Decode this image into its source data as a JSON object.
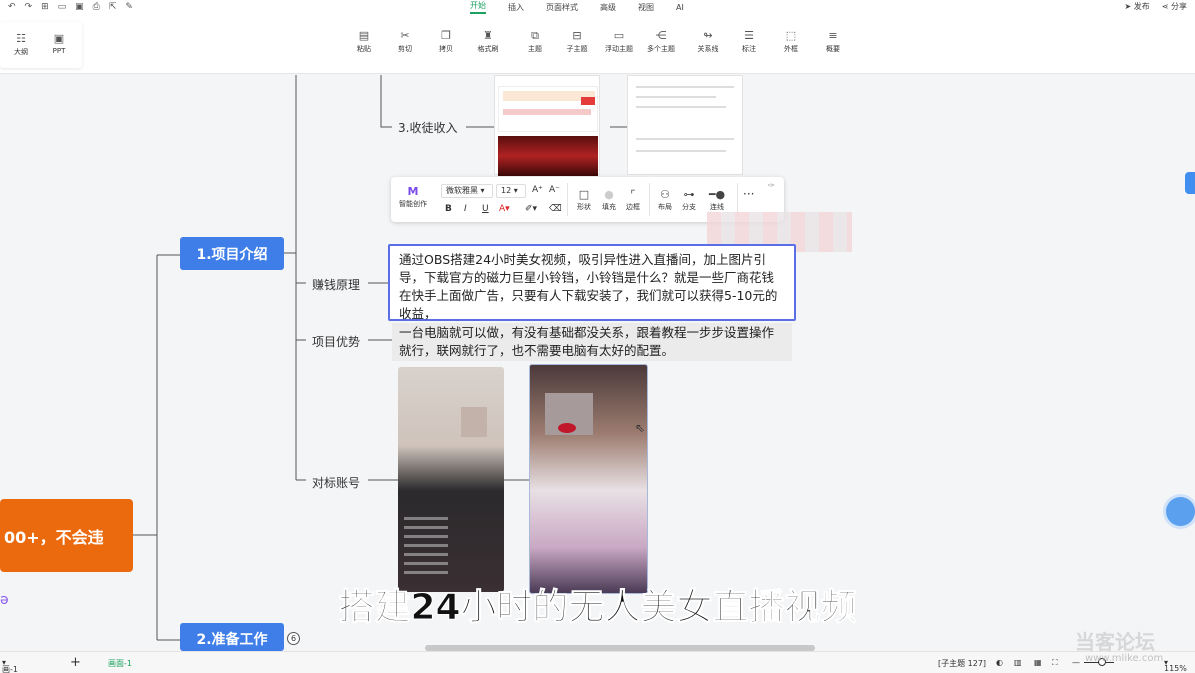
{
  "topbar": {
    "menus": [
      "开始",
      "插入",
      "页面样式",
      "高级",
      "视图",
      "AI"
    ],
    "active_menu": "开始",
    "publish": "发布",
    "share": "分享"
  },
  "left_panel": {
    "outline": "大纲",
    "ppt": "PPT"
  },
  "ribbon": [
    {
      "label": "粘贴",
      "icon": "clipboard-icon"
    },
    {
      "label": "剪切",
      "icon": "scissors-icon"
    },
    {
      "label": "拷贝",
      "icon": "copy-icon"
    },
    {
      "label": "格式刷",
      "icon": "format-brush-icon"
    },
    {
      "label": "主题",
      "icon": "topic-icon"
    },
    {
      "label": "子主题",
      "icon": "subtopic-icon"
    },
    {
      "label": "浮动主题",
      "icon": "floating-topic-icon"
    },
    {
      "label": "多个主题",
      "icon": "multi-topic-icon"
    },
    {
      "label": "关系线",
      "icon": "relation-line-icon"
    },
    {
      "label": "标注",
      "icon": "callout-icon"
    },
    {
      "label": "外框",
      "icon": "boundary-icon"
    },
    {
      "label": "概要",
      "icon": "summary-icon"
    }
  ],
  "toolbar": {
    "ai_label": "智能创作",
    "font": "微软雅黑",
    "size": "12",
    "shape": "形状",
    "fill": "填充",
    "border": "边框",
    "layout": "布局",
    "branch": "分支",
    "line_style": "连线"
  },
  "nodes": {
    "main": "00+，不会违",
    "intro": "1.项目介绍",
    "prep": "2.准备工作",
    "prep_badge": "6",
    "income": "3.收徒收入",
    "principle": "赚钱原理",
    "advantage": "项目优势",
    "benchmark": "对标账号"
  },
  "principle_text": "通过OBS搭建24小时美女视频，吸引异性进入直播间，加上图片引导，下载官方的磁力巨星小铃铛，小铃铛是什么？就是一些厂商花钱在快手上面做广告，只要有人下载安装了，我们就可以获得5-10元的收益，",
  "advantage_text": "一台电脑就可以做，有没有基础都没关系，跟着教程一步步设置操作就行，联网就行了，也不需要电脑有太好的配置。",
  "subtitle": "搭建24小时的无人美女直播视频",
  "statusbar": {
    "page": "画-1",
    "sheet": "画面-1",
    "count": "[子主题 127]",
    "zoom": "115%"
  },
  "watermark": {
    "main": "当客论坛",
    "url": "www.mlike.com"
  }
}
